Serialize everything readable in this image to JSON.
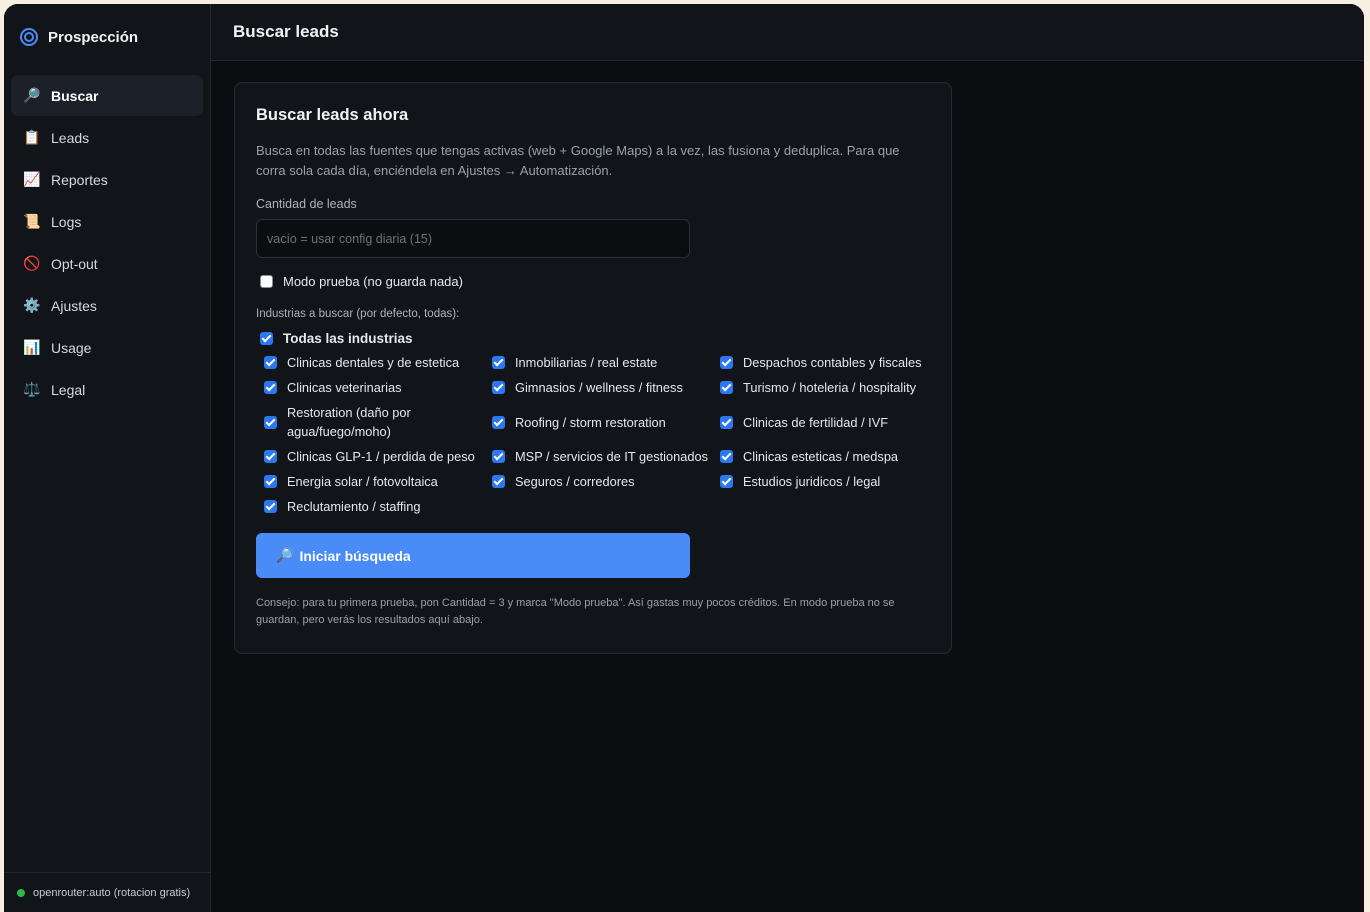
{
  "sidebar": {
    "brand": "Prospección",
    "items": [
      {
        "label": "Buscar",
        "icon": "🔎",
        "icon_name": "magnifier-icon",
        "active": true
      },
      {
        "label": "Leads",
        "icon": "📋",
        "icon_name": "clipboard-icon",
        "active": false
      },
      {
        "label": "Reportes",
        "icon": "📈",
        "icon_name": "chart-up-icon",
        "active": false
      },
      {
        "label": "Logs",
        "icon": "📜",
        "icon_name": "scroll-icon",
        "active": false
      },
      {
        "label": "Opt-out",
        "icon": "🚫",
        "icon_name": "prohibited-icon",
        "active": false
      },
      {
        "label": "Ajustes",
        "icon": "⚙️",
        "icon_name": "gear-icon",
        "active": false
      },
      {
        "label": "Usage",
        "icon": "📊",
        "icon_name": "bar-chart-icon",
        "active": false
      },
      {
        "label": "Legal",
        "icon": "⚖️",
        "icon_name": "scales-icon",
        "active": false
      }
    ],
    "footer_status": "openrouter:auto (rotacion gratis)",
    "status_color": "#2fb84a"
  },
  "header": {
    "title": "Buscar leads"
  },
  "card": {
    "title": "Buscar leads ahora",
    "description": "Busca en todas las fuentes que tengas activas (web + Google Maps) a la vez, las fusiona y deduplica. Para que corra sola cada día, enciéndela en Ajustes → Automatización.",
    "quantity_label": "Cantidad de leads",
    "quantity_value": "",
    "quantity_placeholder": "vacío = usar config diaria (15)",
    "test_mode_label": "Modo prueba (no guarda nada)",
    "test_mode_checked": false,
    "industries_label": "Industrias a buscar (por defecto, todas):",
    "all_industries_label": "Todas las industrias",
    "all_industries_checked": true,
    "industries": [
      {
        "label": "Clinicas dentales y de estetica",
        "checked": true
      },
      {
        "label": "Inmobiliarias / real estate",
        "checked": true
      },
      {
        "label": "Despachos contables y fiscales",
        "checked": true
      },
      {
        "label": "Clinicas veterinarias",
        "checked": true
      },
      {
        "label": "Gimnasios / wellness / fitness",
        "checked": true
      },
      {
        "label": "Turismo / hoteleria / hospitality",
        "checked": true
      },
      {
        "label": "Restoration (daño por agua/fuego/moho)",
        "checked": true
      },
      {
        "label": "Roofing / storm restoration",
        "checked": true
      },
      {
        "label": "Clinicas de fertilidad / IVF",
        "checked": true
      },
      {
        "label": "Clinicas GLP-1 / perdida de peso",
        "checked": true
      },
      {
        "label": "MSP / servicios de IT gestionados",
        "checked": true
      },
      {
        "label": "Clinicas esteticas / medspa",
        "checked": true
      },
      {
        "label": "Energia solar / fotovoltaica",
        "checked": true
      },
      {
        "label": "Seguros / corredores",
        "checked": true
      },
      {
        "label": "Estudios juridicos / legal",
        "checked": true
      },
      {
        "label": "Reclutamiento / staffing",
        "checked": true
      }
    ],
    "search_button_icon": "🔎",
    "search_button_label": "Iniciar búsqueda",
    "tip": "Consejo: para tu primera prueba, pon Cantidad = 3 y marca \"Modo prueba\". Así gastas muy pocos créditos. En modo prueba no se guardan, pero verás los resultados aquí abajo."
  },
  "colors": {
    "accent": "#4a8cf7",
    "checkbox_on": "#2b78f0",
    "background": "#0b0d10",
    "panel": "#111419"
  }
}
